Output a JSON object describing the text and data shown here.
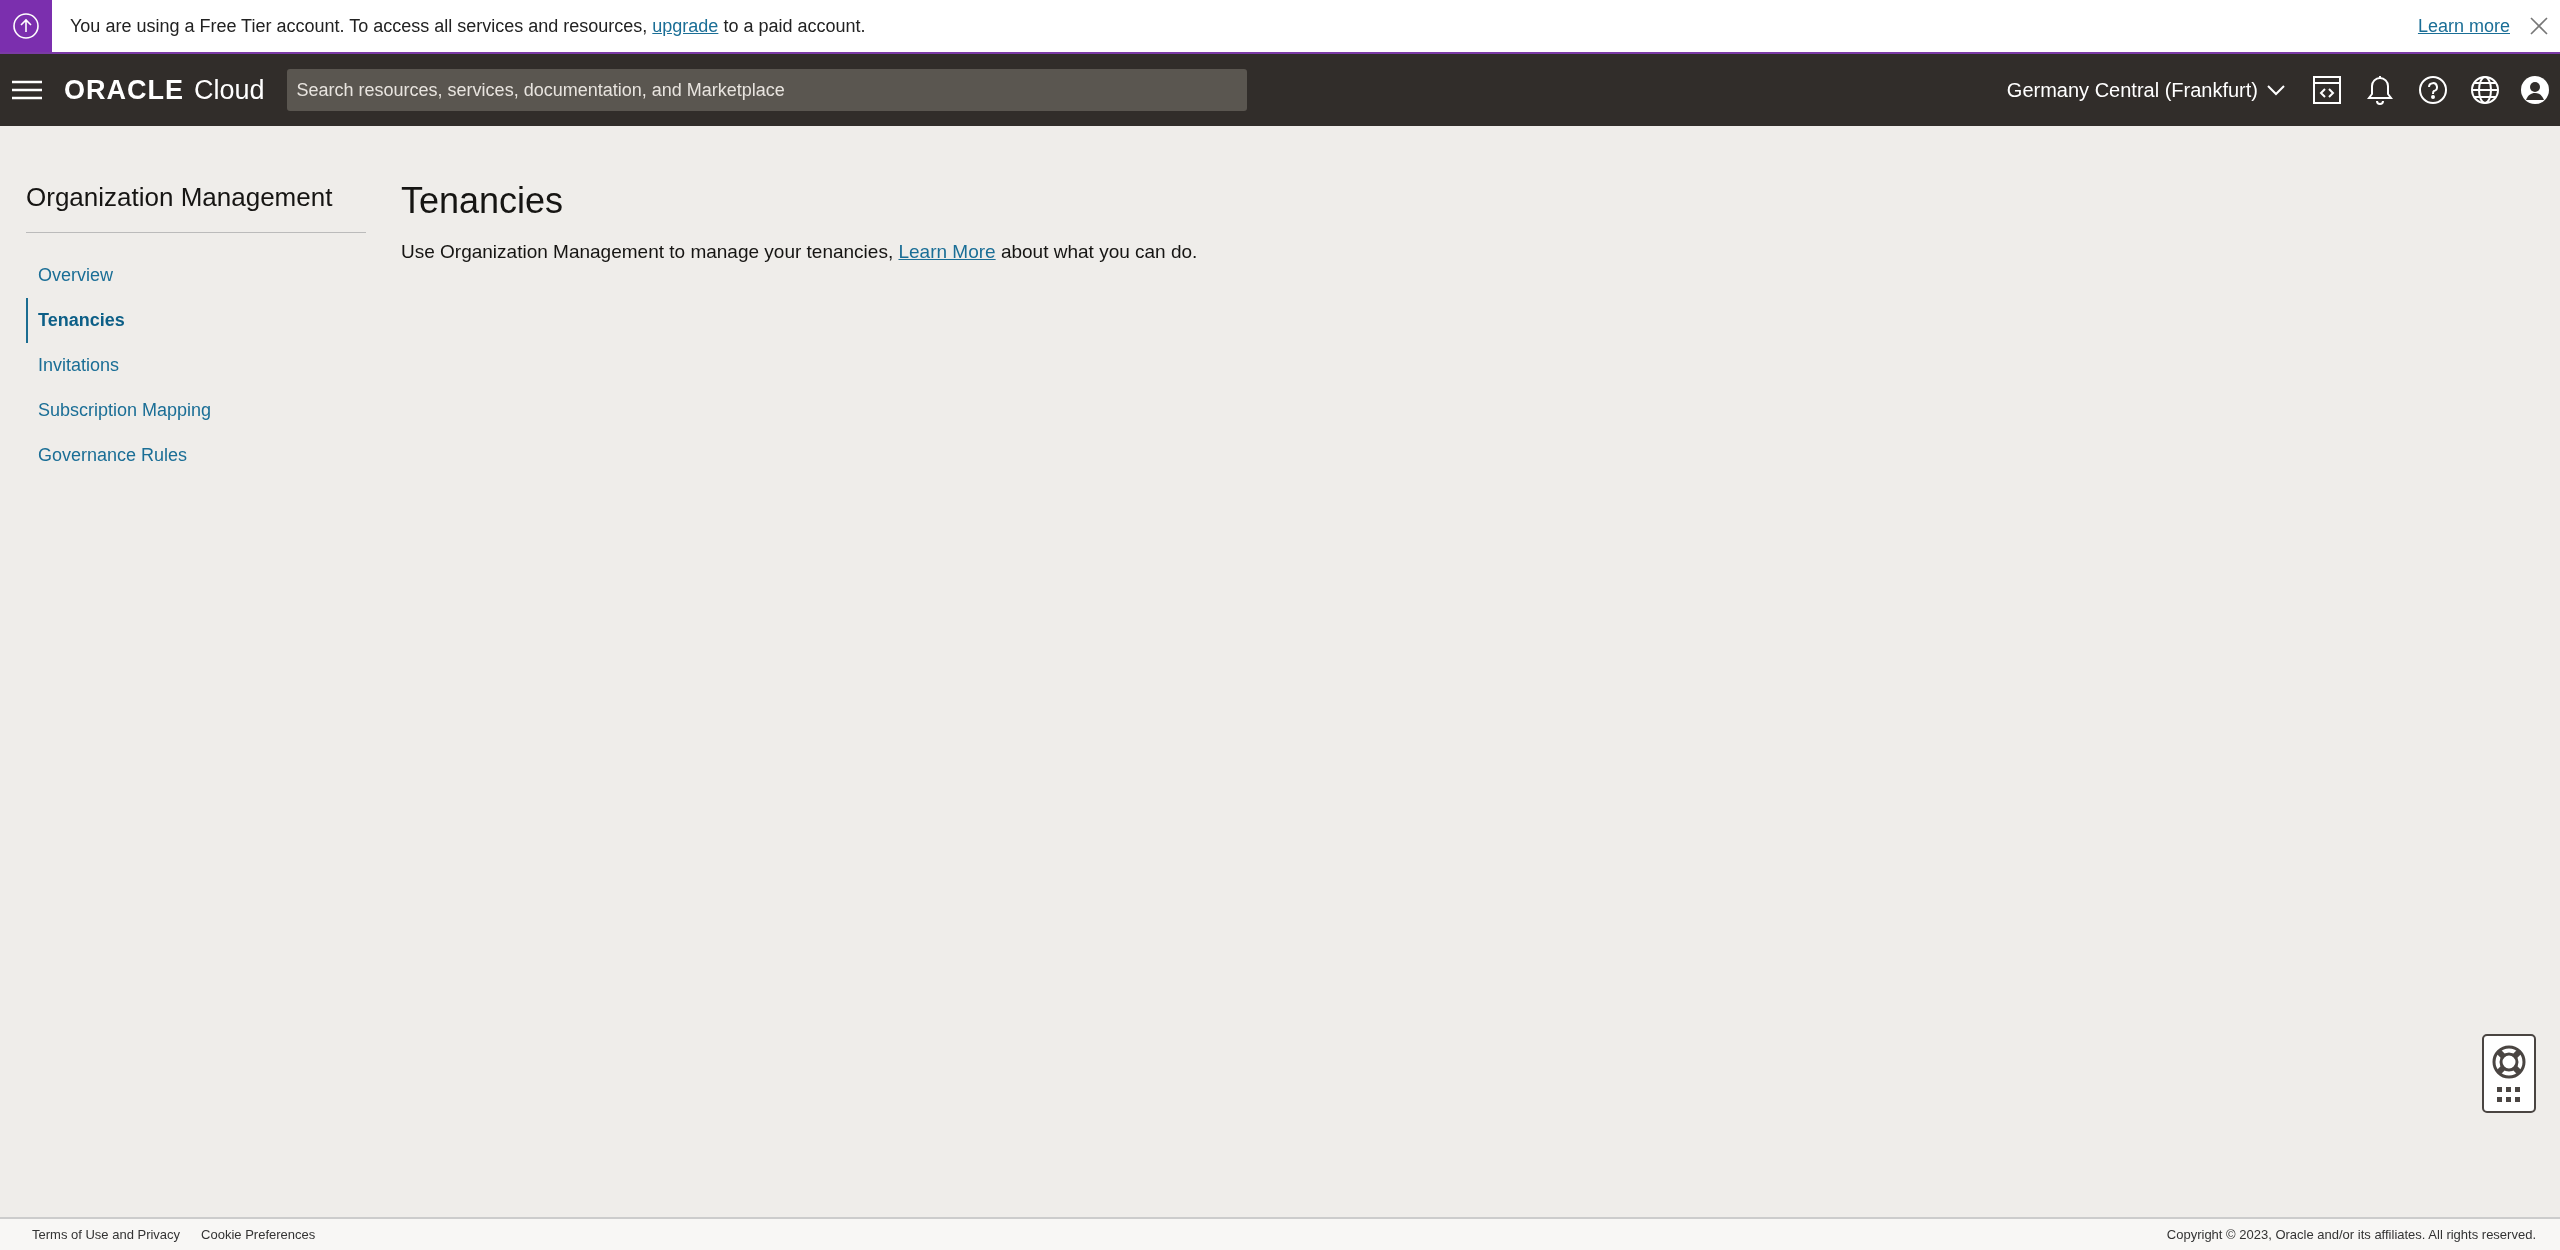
{
  "banner": {
    "text": "You are using a Free Tier account. To access all services and resources, ",
    "link": "upgrade",
    "text_after": " to a paid account.",
    "learn_more": "Learn more"
  },
  "header": {
    "logo_brand": "ORACLE",
    "logo_product": "Cloud",
    "search": {
      "placeholder": "Search resources, services, documentation, and Marketplace"
    },
    "region": "Germany Central (Frankfurt)"
  },
  "sidebar": {
    "title": "Organization Management",
    "items": [
      {
        "label": "Overview",
        "selected": false
      },
      {
        "label": "Tenancies",
        "selected": true
      },
      {
        "label": "Invitations",
        "selected": false
      },
      {
        "label": "Subscription Mapping",
        "selected": false
      },
      {
        "label": "Governance Rules",
        "selected": false
      }
    ]
  },
  "main": {
    "title": "Tenancies",
    "description_before": "Use Organization Management to manage your tenancies, ",
    "description_link": "Learn More",
    "description_after": " about what you can do."
  },
  "footer": {
    "links": [
      "Terms of Use and Privacy",
      "Cookie Preferences"
    ],
    "copyright": "Copyright © 2023, Oracle and/or its affiliates. All rights reserved."
  }
}
